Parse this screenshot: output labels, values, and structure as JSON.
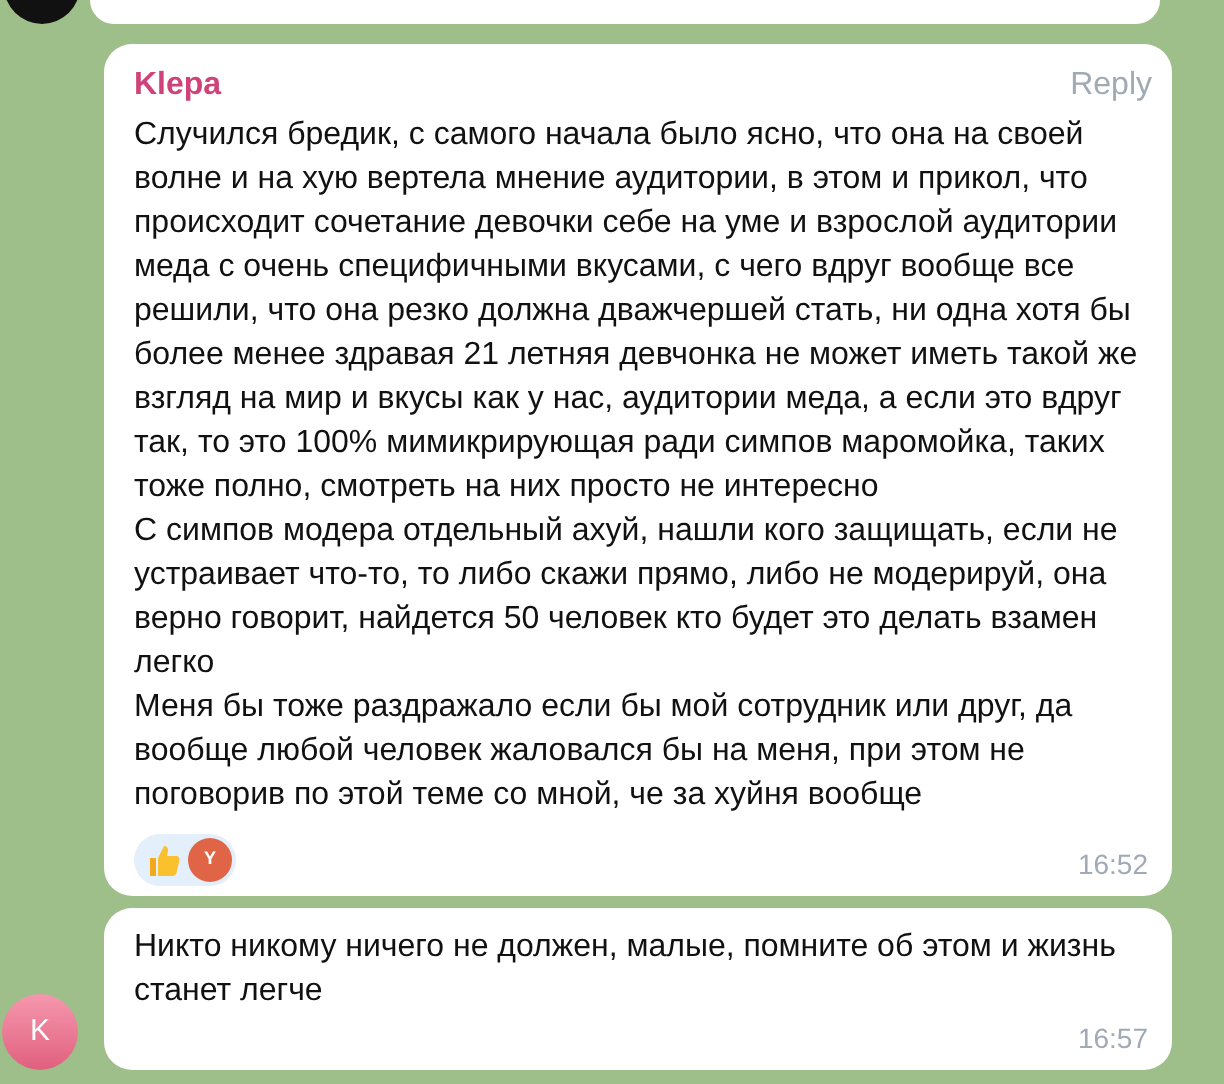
{
  "messages": [
    {
      "kind": "partial"
    },
    {
      "kind": "full",
      "sender": "Klepa",
      "reply": "Reply",
      "paragraphs": [
        "Случился бредик, с самого начала было ясно, что она на своей волне и на хую вертела мнение аудитории, в этом и прикол, что происходит сочетание девочки себе на уме и взрослой аудитории меда с очень специфичными вкусами, с чего вдруг вообще все решили, что она резко должна дважчершей стать, ни одна хотя бы более менее здравая 21 летняя девчонка не может иметь такой же взгляд на мир и вкусы как у нас, аудитории меда, а если это вдруг так, то это 100% мимикрирующая ради симпов маромойка, таких тоже полно, смотреть на них просто не интересно",
        "С симпов модера отдельный ахуй, нашли кого защищать, если не устраивает что-то, то либо скажи прямо, либо не модерируй, она верно говорит, найдется 50 человек кто будет это делать взамен легко",
        "Меня бы тоже раздражало если бы мой сотрудник или друг, да вообще любой человек жаловался бы на меня, при этом не поговорив по этой теме со мной, че за хуйня вообще"
      ],
      "reactions": [
        {
          "kind": "thumbs"
        },
        {
          "kind": "avatar",
          "initial": "Y"
        }
      ],
      "time": "16:52"
    },
    {
      "kind": "full",
      "avatar": "K",
      "paragraphs": [
        "Никто никому ничего не должен, малые, помните об этом и жизнь станет легче"
      ],
      "time": "16:57"
    }
  ]
}
